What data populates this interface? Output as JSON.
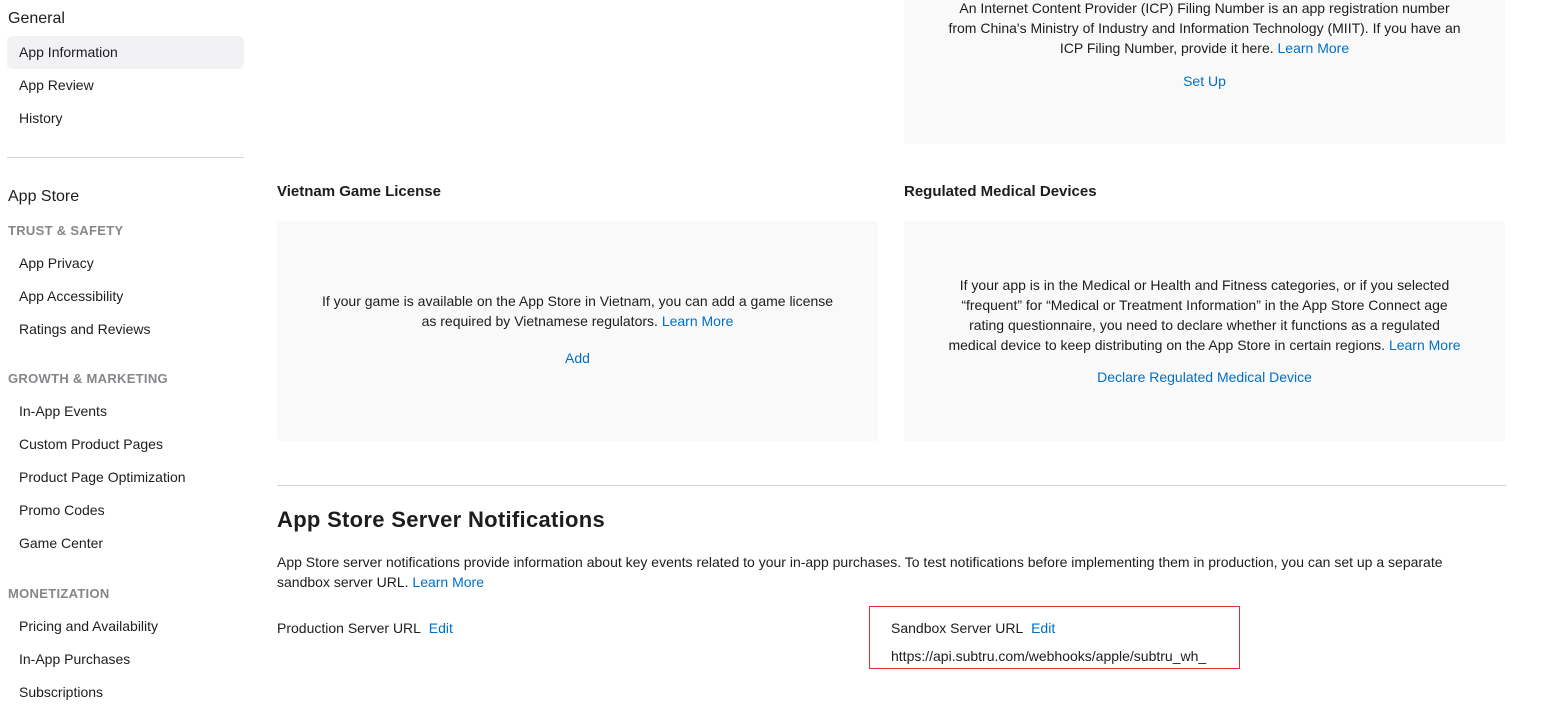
{
  "sidebar": {
    "general_title": "General",
    "general_items": [
      "App Information",
      "App Review",
      "History"
    ],
    "app_store_title": "App Store",
    "groups": {
      "trust_safety": {
        "label": "TRUST & SAFETY",
        "items": [
          "App Privacy",
          "App Accessibility",
          "Ratings and Reviews"
        ]
      },
      "growth_marketing": {
        "label": "GROWTH & MARKETING",
        "items": [
          "In-App Events",
          "Custom Product Pages",
          "Product Page Optimization",
          "Promo Codes",
          "Game Center"
        ]
      },
      "monetization": {
        "label": "MONETIZATION",
        "items": [
          "Pricing and Availability",
          "In-App Purchases",
          "Subscriptions"
        ]
      }
    }
  },
  "icp": {
    "text_line1": "An Internet Content Provider (ICP) Filing Number is an app registration number",
    "text_line2": "from China's Ministry of Industry and Information Technology (MIIT). If you have an",
    "text_line3": "ICP Filing Number, provide it here.",
    "learn_more": "Learn More",
    "action": "Set Up"
  },
  "vietnam": {
    "title": "Vietnam Game License",
    "text_line1": "If your game is available on the App Store in Vietnam, you can add a game license",
    "text_line2": "as required by Vietnamese regulators.",
    "learn_more": "Learn More",
    "action": "Add"
  },
  "medical": {
    "title": "Regulated Medical Devices",
    "text_line1": "If your app is in the Medical or Health and Fitness categories, or if you selected",
    "text_line2": "“frequent” for “Medical or Treatment Information” in the App Store Connect age",
    "text_line3": "rating questionnaire, you need to declare whether it functions as a regulated",
    "text_line4": "medical device to keep distributing on the App Store in certain regions.",
    "learn_more": "Learn More",
    "action": "Declare Regulated Medical Device"
  },
  "notifications": {
    "heading": "App Store Server Notifications",
    "description": "App Store server notifications provide information about key events related to your in-app purchases. To test notifications before implementing them in production, you can set up a separate sandbox server URL.",
    "learn_more": "Learn More",
    "production_label": "Production Server URL",
    "production_edit": "Edit",
    "sandbox_label": "Sandbox Server URL",
    "sandbox_edit": "Edit",
    "sandbox_url": "https://api.subtru.com/webhooks/apple/subtru_wh_"
  },
  "colors": {
    "link": "#0070c9",
    "highlight": "#d9362b",
    "card_bg": "#f9f9f9"
  }
}
